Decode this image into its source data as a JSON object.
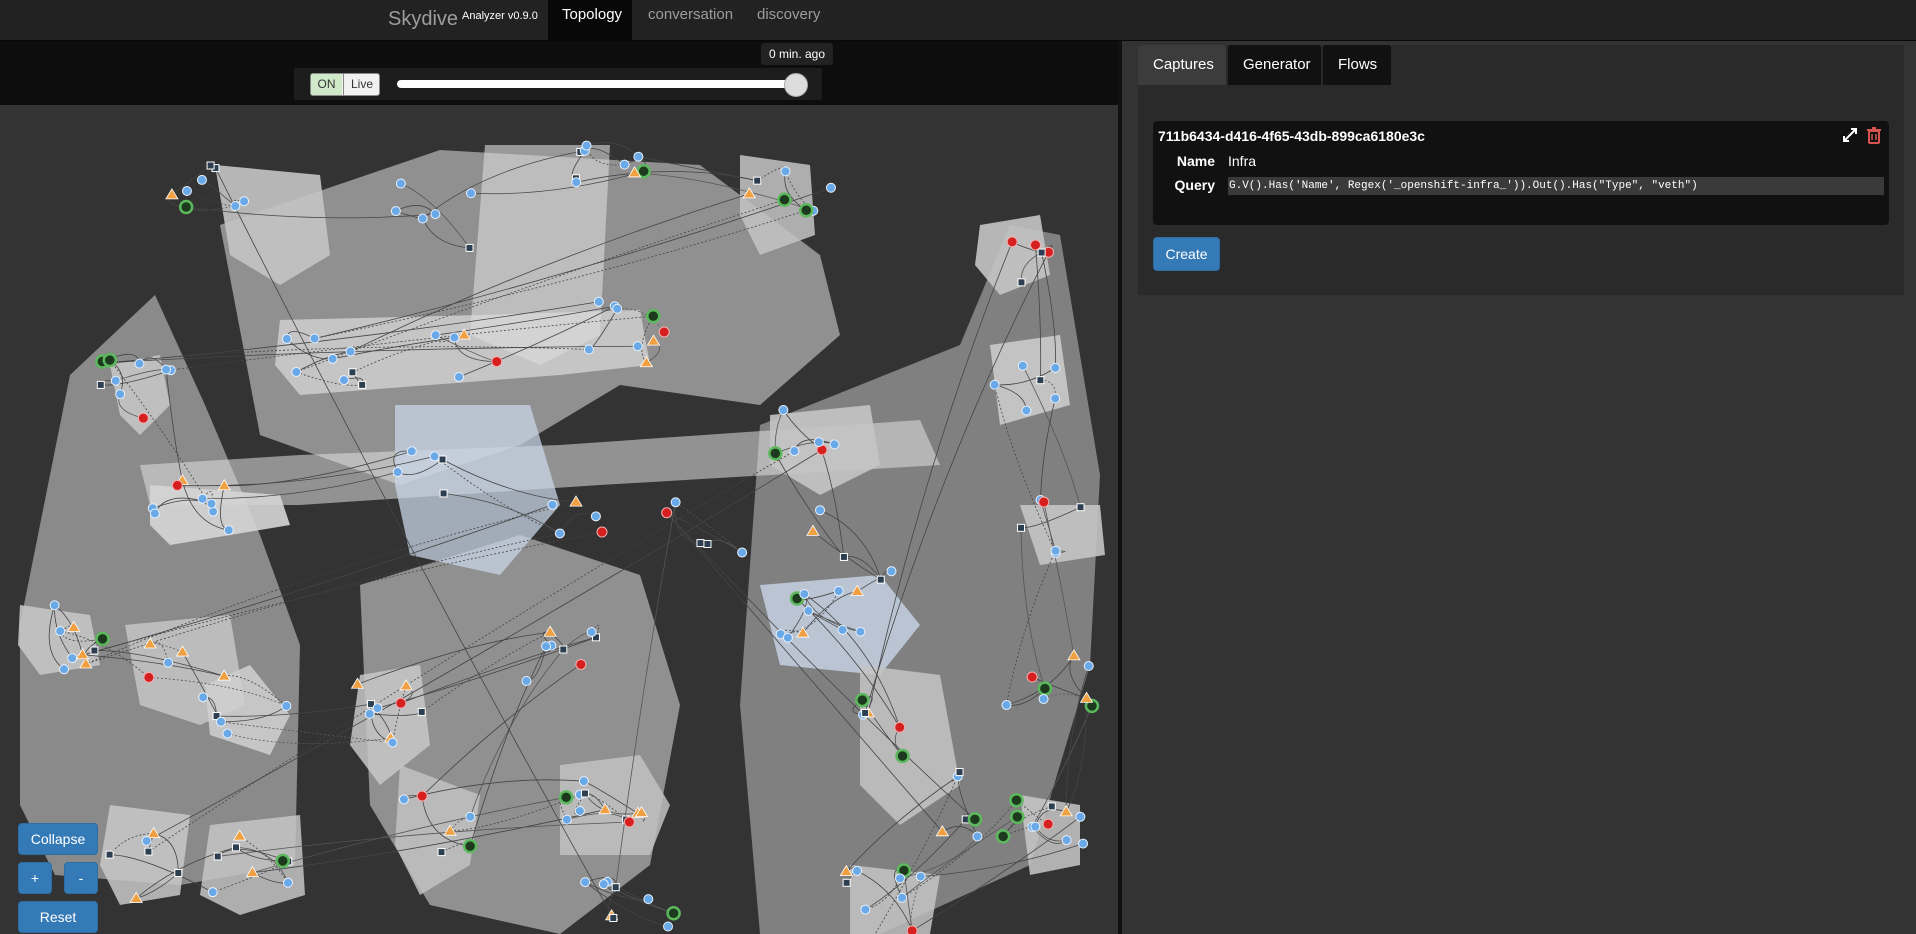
{
  "navbar": {
    "brand": "Skydive",
    "version": "Analyzer v0.9.0",
    "tabs": [
      {
        "label": "Topology",
        "active": true
      },
      {
        "label": "conversation",
        "active": false
      },
      {
        "label": "discovery",
        "active": false
      }
    ]
  },
  "timeline": {
    "toggle_on": "ON",
    "toggle_live": "Live",
    "tooltip": "0 min. ago",
    "position": 1.0
  },
  "controls": {
    "collapse": "Collapse",
    "zoom_in": "+",
    "zoom_out": "-",
    "reset": "Reset"
  },
  "right": {
    "tabs": [
      {
        "label": "Captures",
        "active": true
      },
      {
        "label": "Generator",
        "active": false
      },
      {
        "label": "Flows",
        "active": false
      }
    ],
    "capture": {
      "id": "711b6434-d416-4f65-43db-899ca6180e3c",
      "name_label": "Name",
      "name": "Infra",
      "query_label": "Query",
      "query": "G.V().Has('Name', Regex('_openshift-infra_')).Out().Has(\"Type\", \"veth\")"
    },
    "create": "Create"
  },
  "colors": {
    "accent": "#337ab7",
    "danger": "#d9534f",
    "node_blue": "#6aa9e8",
    "node_orange": "#f0a040",
    "node_red": "#d62020",
    "node_green": "#5cb85c"
  },
  "icons": {
    "expand": "expand-icon",
    "delete": "trash-icon"
  }
}
